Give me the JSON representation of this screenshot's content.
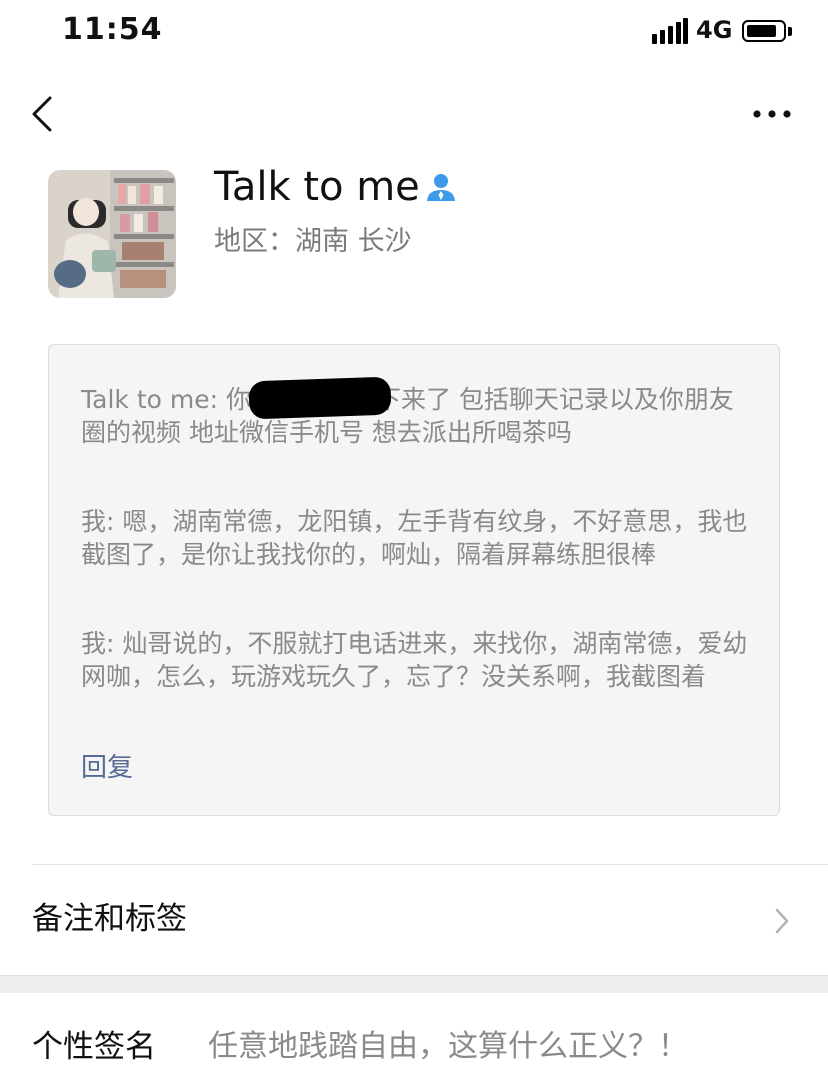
{
  "status_bar": {
    "time": "11:54",
    "network": "4G",
    "battery_level": 0.85
  },
  "nav": {
    "back_icon": "chevron-left-icon",
    "more_icon": "ellipsis-icon"
  },
  "profile": {
    "name": "Talk to me",
    "verify_icon": "person-icon",
    "region": "地区：湖南 长沙"
  },
  "messages": [
    {
      "text": "Talk to me: 你这个我全拍下来了 包括聊天记录以及你朋友圈的视频 地址微信手机号  想去派出所喝茶吗"
    },
    {
      "text": "我: 嗯，湖南常德，龙阳镇，左手背有纹身，不好意思，我也截图了，是你让我找你的，啊灿，隔着屏幕练胆很棒"
    },
    {
      "text": "我: 灿哥说的，不服就打电话进来，来找你，湖南常德，爱幼网咖，怎么，玩游戏玩久了，忘了？没关系啊，我截图着"
    }
  ],
  "reply_label": "回复",
  "remark_row": {
    "label": "备注和标签",
    "icon": "chevron-right-icon"
  },
  "signature_row": {
    "label": "个性签名",
    "value": "任意地践踏自由，这算什么正义？！"
  },
  "colors": {
    "link": "#576b95",
    "verify": "#3d9ae8",
    "muted_text": "#8a8a8a",
    "box_bg": "#f5f5f5"
  }
}
